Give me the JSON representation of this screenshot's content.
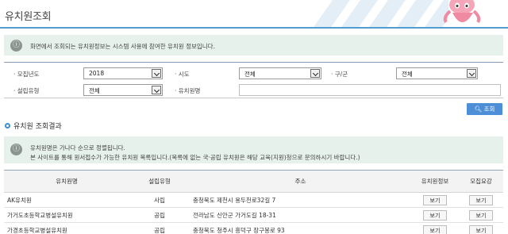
{
  "header": {
    "title": "유치원조회"
  },
  "notice": {
    "text": "화면에서 조회되는 유치원정보는 시스템 사용에 참여한 유치원 정보입니다."
  },
  "search": {
    "year_label": "· 모집년도",
    "year_value": "2018",
    "sido_label": "· 시도",
    "sido_value": "전체",
    "gugun_label": "· 구/군",
    "gugun_value": "전체",
    "type_label": "· 설립유형",
    "type_value": "전체",
    "name_label": "· 유치원명",
    "name_value": "",
    "button_label": "조회"
  },
  "results": {
    "title": "유치원 조회결과",
    "notice_line1": "유치원명은 가나다 순으로 정렬됩니다.",
    "notice_line2": "본 사이트를 통해 원서접수가 가능한 유치원 목록입니다.(목록에 없는 국·공립 유치원은 해당 교육(지원)청으로 문의하시기 바랍니다.)",
    "columns": [
      "유치원명",
      "설립유형",
      "주소",
      "유치원정보",
      "모집요강"
    ],
    "view_label": "보기",
    "rows": [
      {
        "name": "AK유치원",
        "type": "사립",
        "address": "충청북도 제천시 용두천로32길 7"
      },
      {
        "name": "가거도초등학교병설유치원",
        "type": "공립",
        "address": "전라남도 신안군 가거도길 18-31"
      },
      {
        "name": "가경초등학교병설유치원",
        "type": "공립",
        "address": "충청북도 청주시 흥덕구 장구봉로 93"
      }
    ]
  }
}
